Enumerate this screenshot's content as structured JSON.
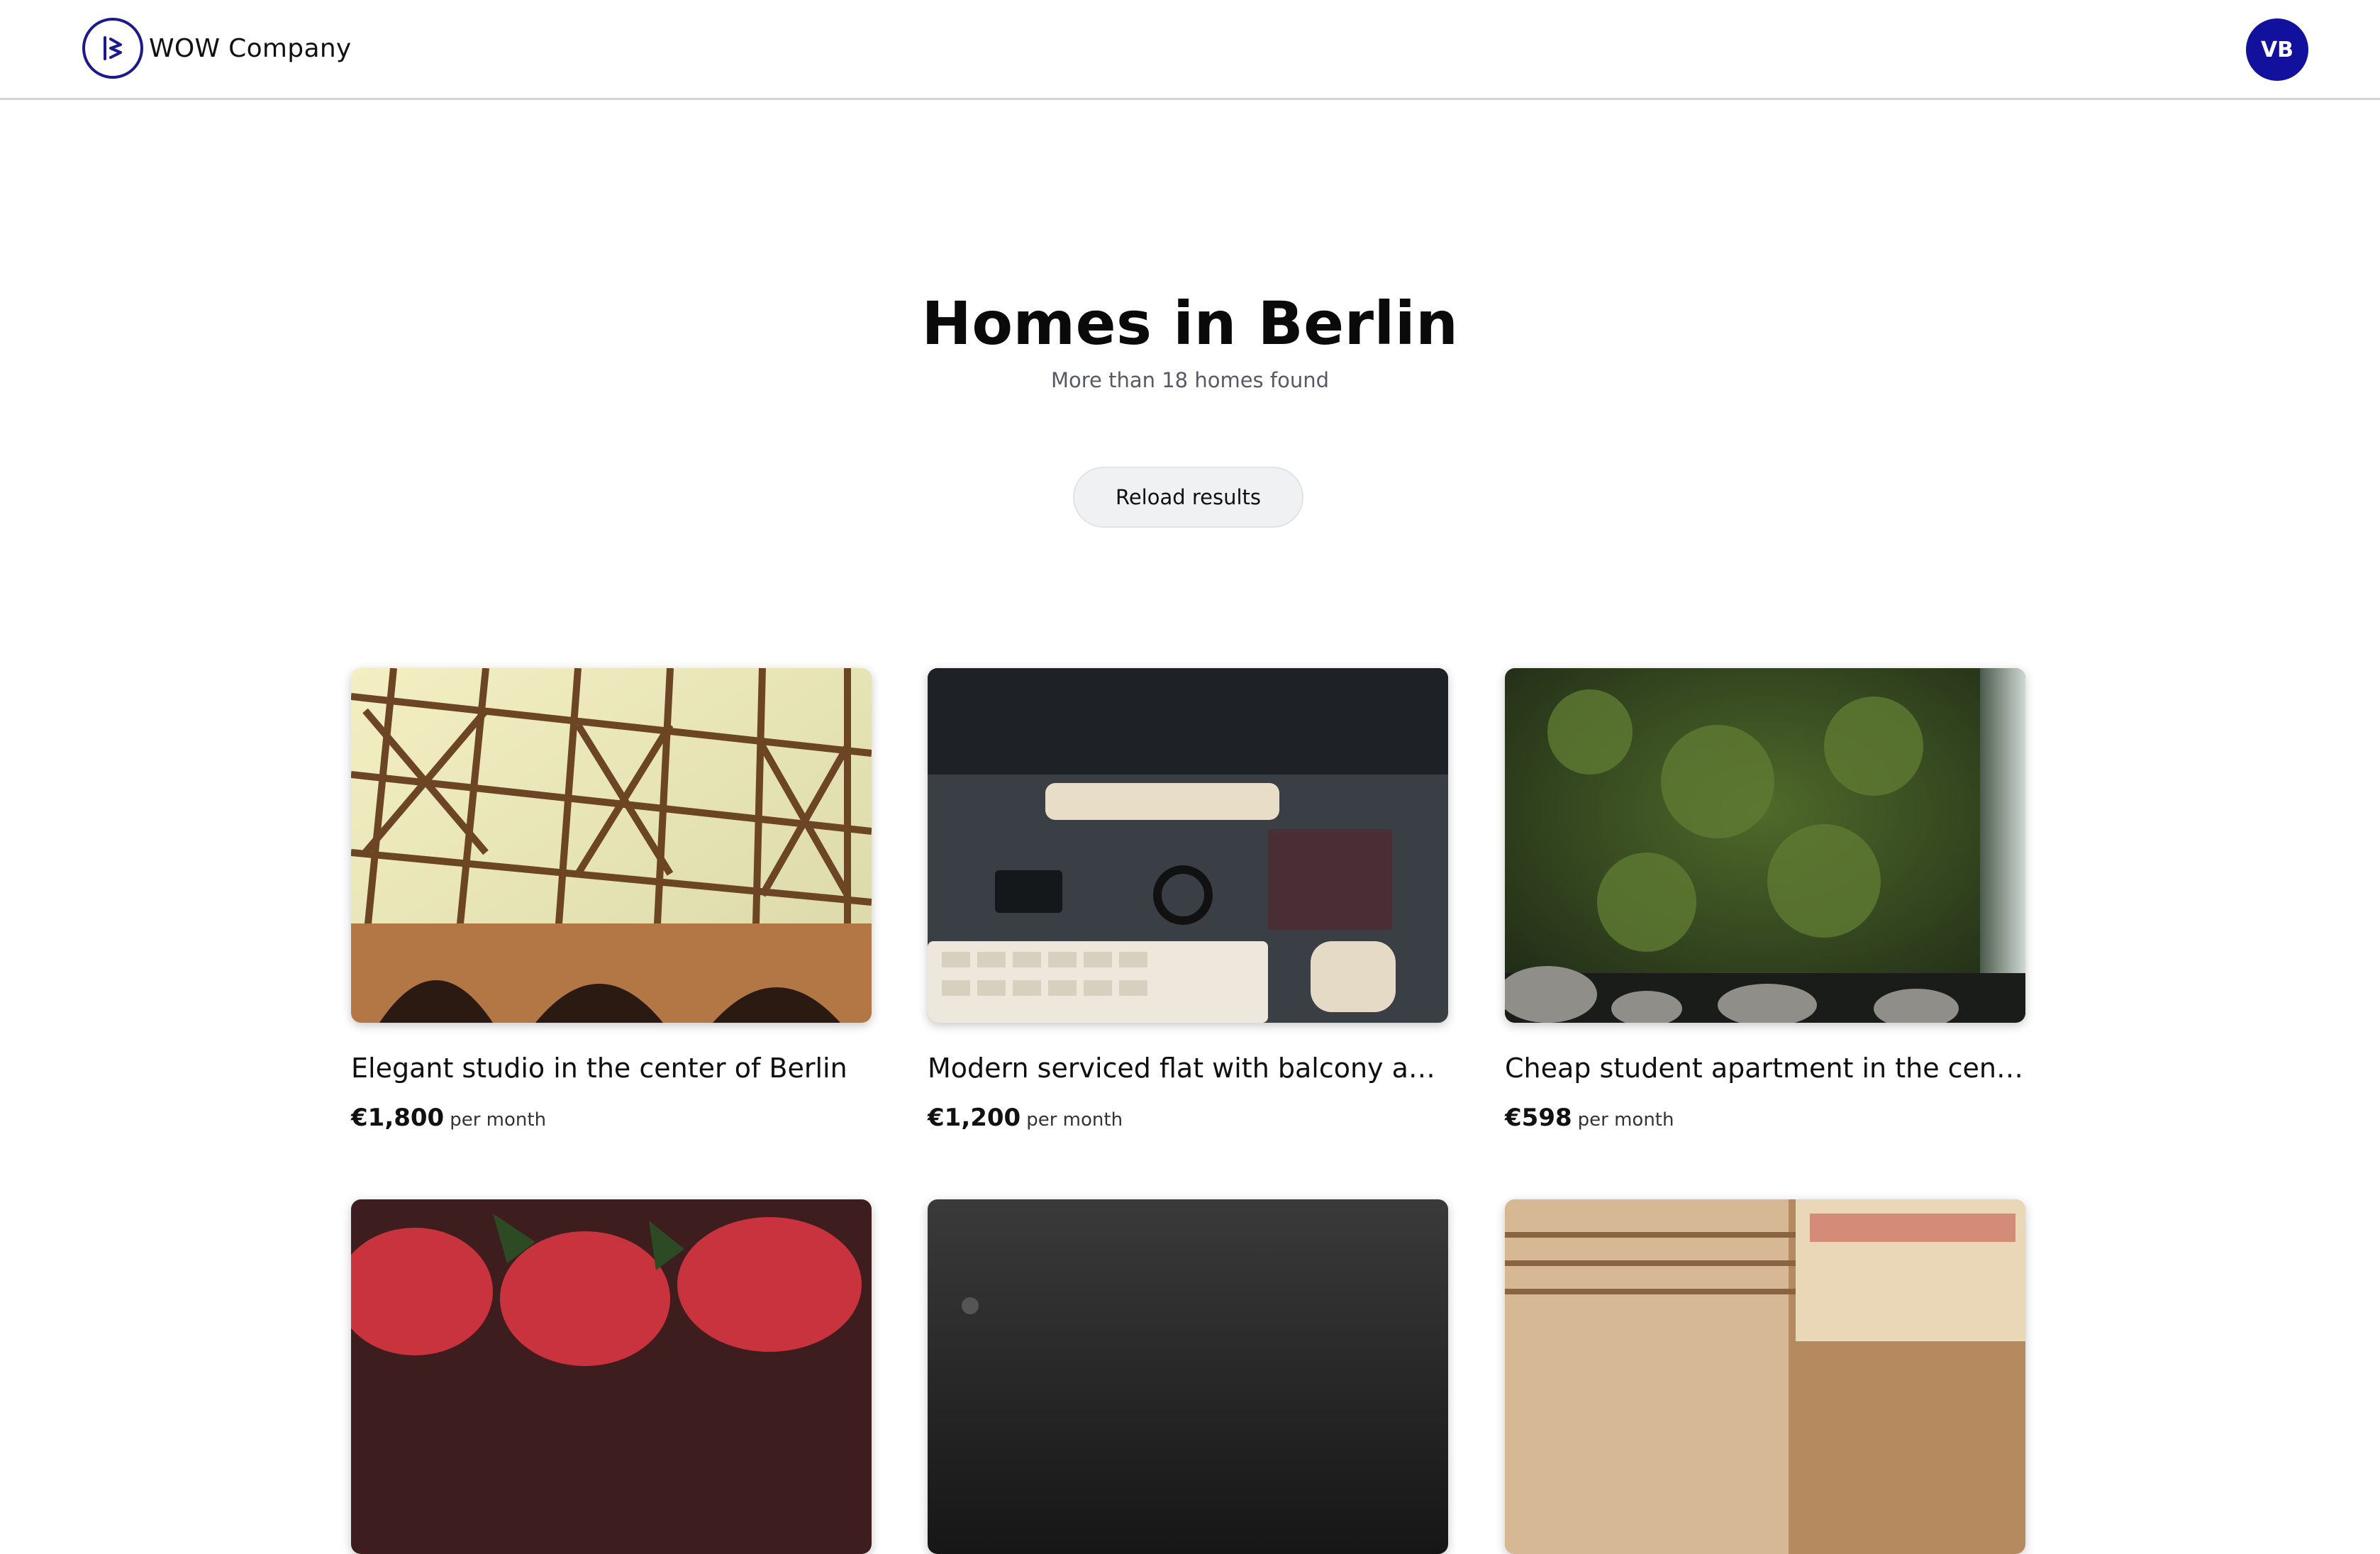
{
  "header": {
    "brand_name": "WOW Company",
    "avatar_initials": "VB"
  },
  "hero": {
    "title": "Homes in Berlin",
    "subtitle": "More than 18 homes found",
    "reload_label": "Reload results"
  },
  "listings": [
    {
      "title": "Elegant studio in the center of Berlin",
      "price": "€1,800",
      "price_unit": "per month"
    },
    {
      "title": "Modern serviced flat with balcony and...",
      "price": "€1,200",
      "price_unit": "per month"
    },
    {
      "title": "Cheap student apartment in the cent...",
      "price": "€598",
      "price_unit": "per month"
    }
  ],
  "colors": {
    "brand": "#1a1a8c",
    "avatar_bg": "#11119e",
    "button_bg": "#f0f1f3"
  }
}
